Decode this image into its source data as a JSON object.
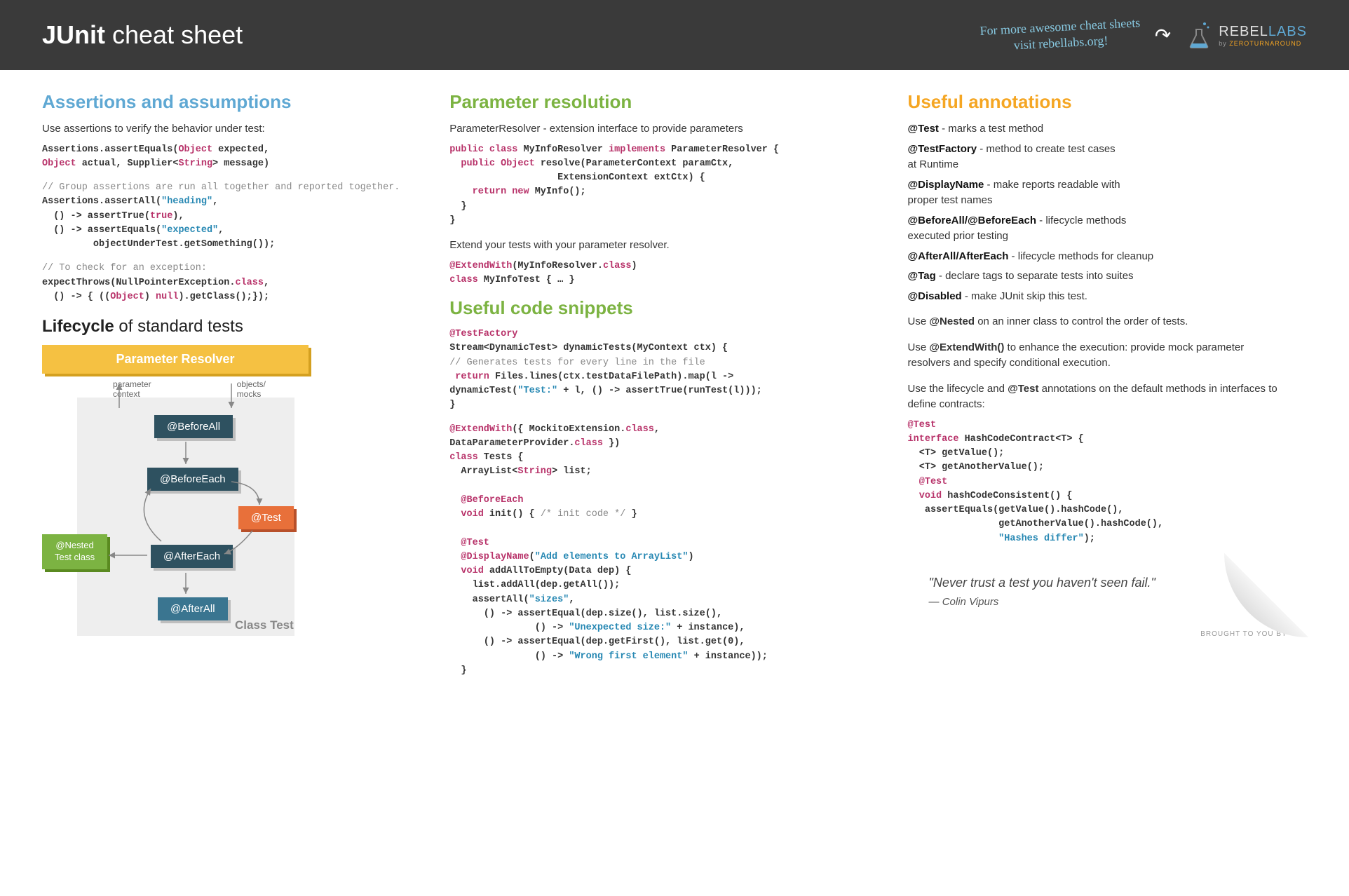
{
  "header": {
    "title_bold": "JUnit",
    "title_rest": " cheat sheet",
    "note_line1": "For more awesome cheat sheets",
    "note_line2": "visit rebellabs.org!",
    "logo_main": "REBEL",
    "logo_labs": "LABS",
    "logo_by": "by ",
    "logo_zt": "ZEROTURNAROUND"
  },
  "col1": {
    "h_assertions": "Assertions and assumptions",
    "p_assertions": "Use assertions to verify the behavior under test:",
    "code_assert_html": "Assertions.assertEquals(<span class='kw'>Object</span> expected,\n<span class='kw'>Object</span> actual, Supplier&lt;<span class='kw'>String</span>&gt; message)",
    "code_group_html": "<span class='cmt'>// Group assertions are run all together and reported together.</span>\nAssertions.assertAll(<span class='str'>\"heading\"</span>,\n  () -> assertTrue(<span class='kw'>true</span>),\n  () -> assertEquals(<span class='str'>\"expected\"</span>,\n         objectUnderTest.getSomething());",
    "code_exc_html": "<span class='cmt'>// To check for an exception:</span>\nexpectThrows(NullPointerException.<span class='kw'>class</span>,\n  () -> { ((<span class='kw'>Object</span>) <span class='kw'>null</span>).getClass();});",
    "h_lifecycle_b": "Lifecycle",
    "h_lifecycle_r": " of standard tests",
    "diagram": {
      "resolver": "Parameter Resolver",
      "label_left": "parameter\ncontext",
      "label_right": "objects/\nmocks",
      "before_all": "@BeforeAll",
      "before_each": "@BeforeEach",
      "test": "@Test",
      "after_each": "@AfterEach",
      "after_all": "@AfterAll",
      "nested": "@Nested\nTest class",
      "class_test": "Class Test"
    }
  },
  "col2": {
    "h_param": "Parameter resolution",
    "p_param": "ParameterResolver - extension interface to provide parameters",
    "code_resolver_html": "<span class='kw'>public class</span> MyInfoResolver <span class='kw'>implements</span> ParameterResolver {\n  <span class='kw'>public Object</span> resolve(ParameterContext paramCtx,\n                   ExtensionContext extCtx) {\n    <span class='kw'>return new</span> MyInfo();\n  }\n}",
    "p_extend": "Extend your tests with your parameter resolver.",
    "code_extend_html": "<span class='kw'>@ExtendWith</span>(MyInfoResolver.<span class='kw'>class</span>)\n<span class='kw'>class</span> MyInfoTest { … }",
    "h_snippets": "Useful code snippets",
    "code_factory_html": "<span class='kw'>@TestFactory</span>\nStream&lt;DynamicTest&gt; dynamicTests(MyContext ctx) {\n<span class='cmt'>// Generates tests for every line in the file</span>\n <span class='kw'>return</span> Files.lines(ctx.testDataFilePath).map(l -> \ndynamicTest(<span class='str'>\"Test:\"</span> + l, () -> assertTrue(runTest(l)));\n}",
    "code_tests_html": "<span class='kw'>@ExtendWith</span>({ MockitoExtension.<span class='kw'>class</span>,\nDataParameterProvider.<span class='kw'>class</span> })\n<span class='kw'>class</span> Tests {\n  ArrayList&lt;<span class='kw'>String</span>&gt; list;\n\n  <span class='kw'>@BeforeEach</span>\n  <span class='kw'>void</span> init() { <span class='cmt'>/* init code */</span> }\n\n  <span class='kw'>@Test</span>\n  <span class='kw'>@DisplayName</span>(<span class='str'>\"Add elements to ArrayList\"</span>)\n  <span class='kw'>void</span> addAllToEmpty(Data dep) {\n    list.addAll(dep.getAll());\n    assertAll(<span class='str'>\"sizes\"</span>,\n      () -> assertEqual(dep.size(), list.size(),\n               () -> <span class='str'>\"Unexpected size:\"</span> + instance),\n      () -> assertEqual(dep.getFirst(), list.get(0),\n               () -> <span class='str'>\"Wrong first element\"</span> + instance));\n  }"
  },
  "col3": {
    "h_ann": "Useful annotations",
    "annotations": [
      {
        "name": "@Test",
        "desc": " - marks a test method",
        "indent": ""
      },
      {
        "name": "@TestFactory",
        "desc": " - method to create test cases\n          at Runtime",
        "indent": ""
      },
      {
        "name": "@DisplayName",
        "desc": " - make reports readable with\n          proper  test names",
        "indent": ""
      },
      {
        "name": "@BeforeAll/@BeforeEach",
        "desc": " - lifecycle methods\n          executed prior testing",
        "indent": ""
      },
      {
        "name": "@AfterAll/AfterEach",
        "desc": " - lifecycle methods for cleanup",
        "indent": ""
      },
      {
        "name": "@Tag",
        "desc": " - declare tags to separate tests into suites",
        "indent": ""
      },
      {
        "name": "@Disabled",
        "desc": " - make JUnit skip this test.",
        "indent": ""
      }
    ],
    "p_nested_a": "Use ",
    "p_nested_b": "@Nested",
    "p_nested_c": " on an inner class to control the order of tests.",
    "p_extend_a": "Use ",
    "p_extend_b": "@ExtendWith()",
    "p_extend_c": " to enhance the execution: provide mock parameter resolvers and specify conditional execution.",
    "p_lifecycle_a": "Use the lifecycle and ",
    "p_lifecycle_b": "@Test",
    "p_lifecycle_c": " annotations on the default methods in interfaces to define contracts:",
    "code_contract_html": "<span class='kw'>@Test</span>\n<span class='kw'>interface</span> HashCodeContract&lt;T&gt; {\n  &lt;T&gt; getValue();\n  &lt;T&gt; getAnotherValue();\n  <span class='kw'>@Test</span>\n  <span class='kw'>void</span> hashCodeConsistent() {\n   assertEquals(getValue().hashCode(),\n                getAnotherValue().hashCode(),\n                <span class='str'>\"Hashes differ\"</span>);",
    "quote": "\"Never trust a test you haven't seen fail.\"",
    "quote_author": "— Colin Vipurs",
    "brought": "BROUGHT TO YOU BY"
  }
}
